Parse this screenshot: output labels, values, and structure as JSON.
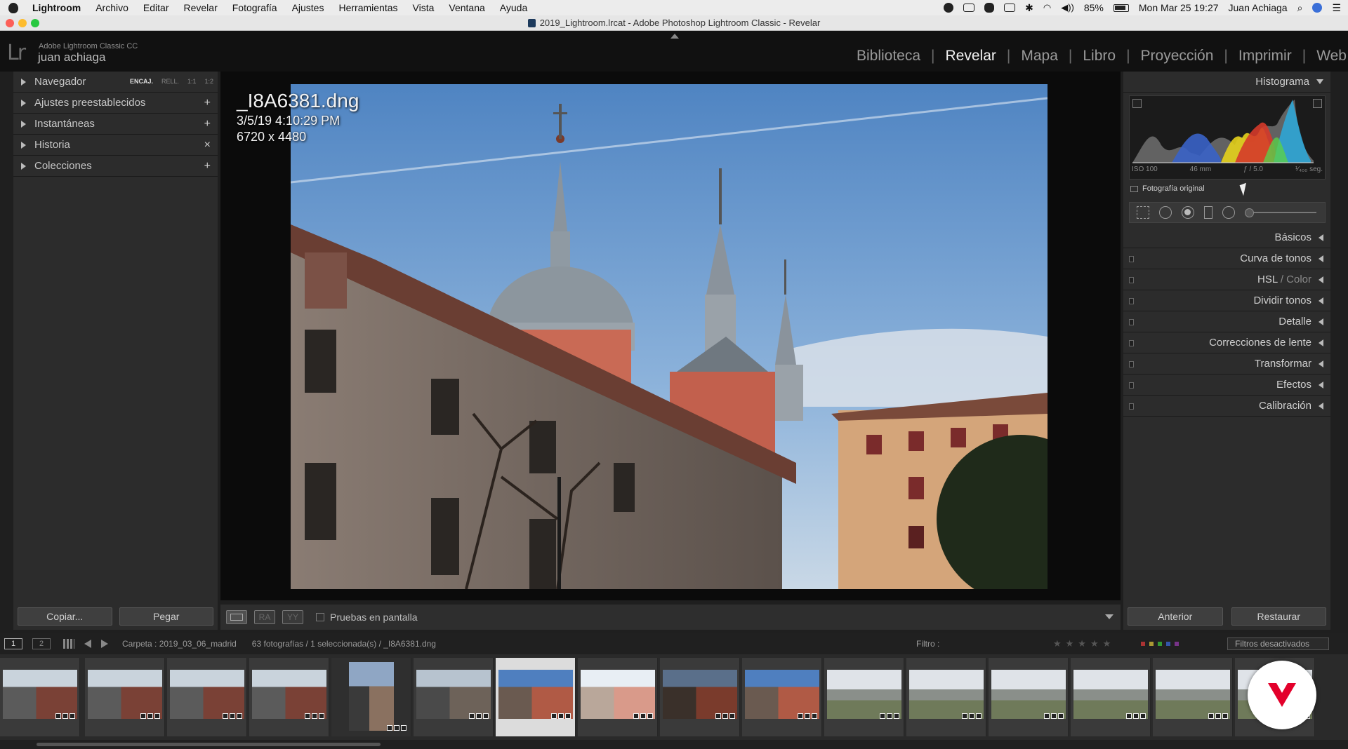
{
  "menubar": {
    "app": "Lightroom",
    "items": [
      "Archivo",
      "Editar",
      "Revelar",
      "Fotografía",
      "Ajustes",
      "Herramientas",
      "Vista",
      "Ventana",
      "Ayuda"
    ],
    "battery": "85%",
    "clock": "Mon Mar 25  19:27",
    "user": "Juan Achiaga"
  },
  "window": {
    "title": "2019_Lightroom.lrcat - Adobe Photoshop Lightroom Classic - Revelar"
  },
  "identity": {
    "logo": "Lr",
    "product": "Adobe Lightroom Classic CC",
    "user": "juan achiaga"
  },
  "modules": {
    "items": [
      "Biblioteca",
      "Revelar",
      "Mapa",
      "Libro",
      "Proyección",
      "Imprimir",
      "Web"
    ],
    "active": "Revelar"
  },
  "left_panel": {
    "navigator": {
      "label": "Navegador",
      "zoom_options": [
        "ENCAJ.",
        "RELL.",
        "1:1",
        "1:2"
      ],
      "zoom_selected": "ENCAJ."
    },
    "sections": [
      {
        "label": "Ajustes preestablecidos",
        "action": "+"
      },
      {
        "label": "Instantáneas",
        "action": "+"
      },
      {
        "label": "Historia",
        "action": "×"
      },
      {
        "label": "Colecciones",
        "action": "+"
      }
    ],
    "copy_button": "Copiar...",
    "paste_button": "Pegar"
  },
  "photo_info": {
    "filename": "_I8A6381.dng",
    "datetime": "3/5/19 4:10:29 PM",
    "dimensions": "6720 x 4480"
  },
  "center_toolbar": {
    "view_before_after_lr": "RA",
    "view_before_after_tb": "YY",
    "soft_proof_label": "Pruebas en pantalla",
    "soft_proof_checked": false
  },
  "right_panel": {
    "histogram_title": "Histograma",
    "exif": {
      "iso": "ISO 100",
      "focal": "46 mm",
      "aperture": "ƒ / 5.0",
      "shutter": "¹⁄₄₀₀ seg."
    },
    "original_photo_label": "Fotografía original",
    "original_photo_checked": false,
    "sections": [
      {
        "label": "Básicos"
      },
      {
        "label": "Curva de tonos"
      },
      {
        "label": "HSL",
        "suffix": "/ Color"
      },
      {
        "label": "Dividir tonos"
      },
      {
        "label": "Detalle"
      },
      {
        "label": "Correcciones de lente"
      },
      {
        "label": "Transformar"
      },
      {
        "label": "Efectos"
      },
      {
        "label": "Calibración"
      }
    ],
    "previous_button": "Anterior",
    "reset_button": "Restaurar"
  },
  "filmstrip_bar": {
    "monitor_1": "1",
    "monitor_2": "2",
    "folder": "Carpeta : 2019_03_06_madrid",
    "count": "63 fotografías / 1 seleccionada(s) / _I8A6381.dng",
    "filter_label": "Filtro :",
    "filter_value": "Filtros desactivados"
  },
  "filmstrip": {
    "selected_index": 6,
    "thumbnails": [
      {
        "scene": "street-brick"
      },
      {
        "scene": "street-brick"
      },
      {
        "scene": "street-brick"
      },
      {
        "scene": "street-brick"
      },
      {
        "scene": "street-portrait"
      },
      {
        "scene": "street-gray"
      },
      {
        "scene": "church-blue"
      },
      {
        "scene": "church-bright"
      },
      {
        "scene": "church-dark"
      },
      {
        "scene": "church-blue"
      },
      {
        "scene": "palace-garden"
      },
      {
        "scene": "palace-garden"
      },
      {
        "scene": "palace-garden"
      },
      {
        "scene": "palace-garden"
      },
      {
        "scene": "palace-garden"
      },
      {
        "scene": "palace-garden"
      }
    ]
  },
  "colors": {
    "accent_white": "#f2f2f2",
    "panel_bg": "#2c2c2c",
    "logo_red": "#e3002b"
  }
}
